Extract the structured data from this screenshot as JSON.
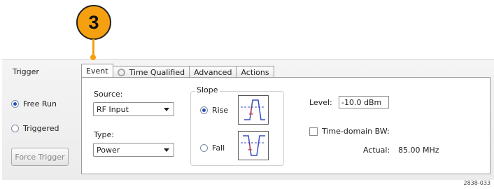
{
  "callout": {
    "number": "3"
  },
  "trigger": {
    "title": "Trigger",
    "free_run": "Free Run",
    "triggered": "Triggered",
    "force_trigger": "Force Trigger",
    "selected_mode": "Free Run"
  },
  "tabs": [
    {
      "label": "Event",
      "active": true
    },
    {
      "label": "Time Qualified",
      "icon": "clock-icon"
    },
    {
      "label": "Advanced"
    },
    {
      "label": "Actions"
    }
  ],
  "event": {
    "source_label": "Source:",
    "source_value": "RF Input",
    "type_label": "Type:",
    "type_value": "Power",
    "slope_label": "Slope",
    "rise_label": "Rise",
    "fall_label": "Fall",
    "selected_slope": "Rise",
    "level_label": "Level:",
    "level_value": "-10.0 dBm",
    "time_domain_bw_label": "Time-domain BW:",
    "time_domain_bw_checked": false,
    "actual_label": "Actual:",
    "actual_value": "85.00 MHz"
  },
  "colors": {
    "callout": "#f5a010",
    "radio_selected": "#2850b8",
    "waveform": "#3a4fc0",
    "trigger_marker": "#d22020"
  },
  "figure_id": "2838-033"
}
